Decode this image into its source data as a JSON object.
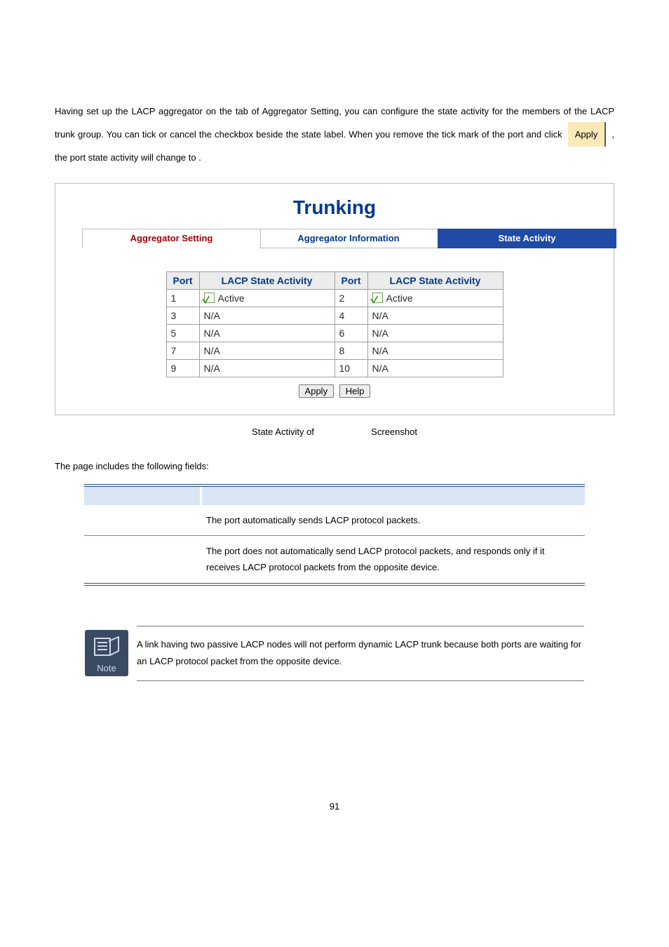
{
  "intro_pre": "Having set up the LACP aggregator on the tab of Aggregator Setting, you can configure the state activity for the members of the LACP trunk group. You can tick or cancel the checkbox beside the state label. When you remove the tick mark of the port and click ",
  "inline_button": "Apply",
  "intro_post_a": ", the port state activity will change to ",
  "intro_post_b": ".",
  "panel": {
    "title": "Trunking",
    "tabs": {
      "aggregator_setting": "Aggregator Setting",
      "aggregator_information": "Aggregator Information",
      "state_activity": "State Activity"
    },
    "headers": {
      "port": "Port",
      "lacp_state_activity": "LACP State Activity"
    },
    "active_label": "Active",
    "rows": [
      {
        "pA": "1",
        "aA": "active",
        "pB": "2",
        "aB": "active"
      },
      {
        "pA": "3",
        "aA": "N/A",
        "pB": "4",
        "aB": "N/A"
      },
      {
        "pA": "5",
        "aA": "N/A",
        "pB": "6",
        "aB": "N/A"
      },
      {
        "pA": "7",
        "aA": "N/A",
        "pB": "8",
        "aB": "N/A"
      },
      {
        "pA": "9",
        "aA": "N/A",
        "pB": "10",
        "aB": "N/A"
      }
    ],
    "buttons": {
      "apply": "Apply",
      "help": "Help"
    }
  },
  "caption_a": "State Activity of",
  "caption_b": "Screenshot",
  "fields_intro": "The page includes the following fields:",
  "field_table": {
    "row1_desc": "The port automatically sends LACP protocol packets.",
    "row2_desc": "The port does not automatically send LACP protocol packets, and responds only if it receives LACP protocol packets from the opposite device."
  },
  "note": {
    "label": "Note",
    "text": "A link having two passive LACP nodes will not perform dynamic LACP trunk because both ports are waiting for an LACP protocol packet from the opposite device."
  },
  "page_number": "91"
}
